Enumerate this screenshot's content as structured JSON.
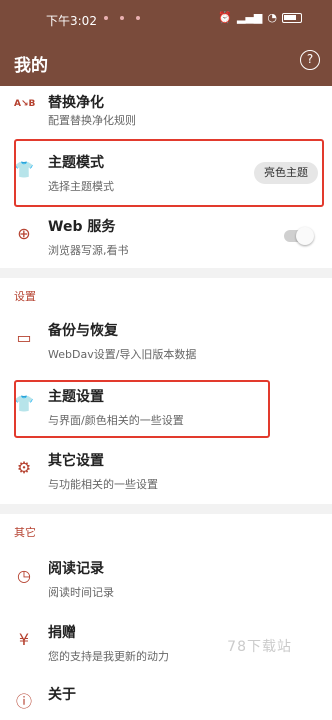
{
  "status_bar": {
    "time": "下午3:02",
    "icons": [
      "alarm-icon",
      "clock-icon",
      "signal-icon",
      "signal-icon",
      "wifi-icon",
      "battery-icon"
    ]
  },
  "app_bar": {
    "title": "我的",
    "help_icon": "help-icon",
    "help_glyph": "?"
  },
  "items": {
    "replace": {
      "title": "替换净化",
      "subtitle": "配置替换净化规则",
      "icon": "replace-icon"
    },
    "theme_mode": {
      "title": "主题模式",
      "subtitle": "选择主题模式",
      "icon": "shirt-icon",
      "value": "亮色主题"
    },
    "web_service": {
      "title": "Web 服务",
      "subtitle": "浏览器写源,看书",
      "icon": "globe-icon",
      "enabled": false
    }
  },
  "settings_section": {
    "header": "设置",
    "items": {
      "backup": {
        "title": "备份与恢复",
        "subtitle": "WebDav设置/导入旧版本数据",
        "icon": "folder-icon"
      },
      "theme_settings": {
        "title": "主题设置",
        "subtitle": "与界面/颜色相关的一些设置",
        "icon": "shirt-icon"
      },
      "other_settings": {
        "title": "其它设置",
        "subtitle": "与功能相关的一些设置",
        "icon": "gear-icon"
      }
    }
  },
  "other_section": {
    "header": "其它",
    "items": {
      "history": {
        "title": "阅读记录",
        "subtitle": "阅读时间记录",
        "icon": "clock-icon"
      },
      "donate": {
        "title": "捐赠",
        "subtitle": "您的支持是我更新的动力",
        "icon": "yen-icon"
      },
      "about": {
        "title": "关于",
        "subtitle": "",
        "icon": "info-icon"
      }
    }
  },
  "highlight_color": "#e23a2d",
  "accent_color": "#b5412f",
  "appbar_color": "#7a4b3b",
  "watermark": "78下载站"
}
